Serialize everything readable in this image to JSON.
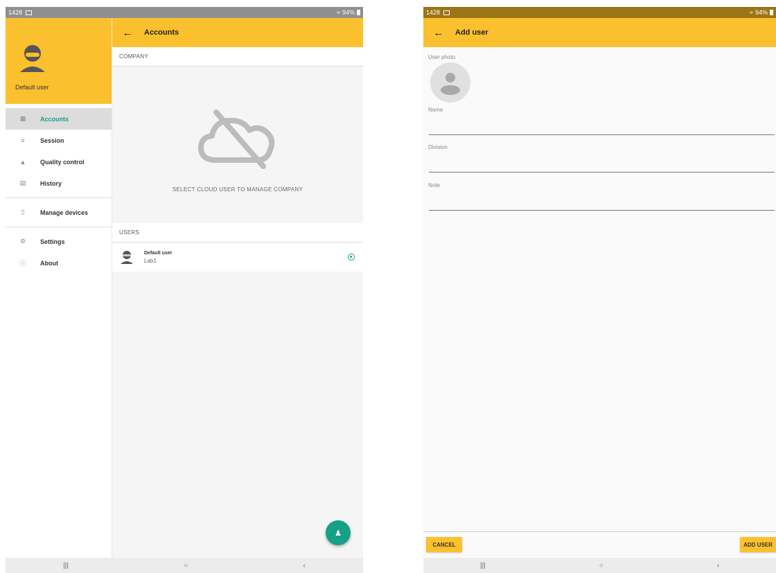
{
  "status_bar": {
    "time": "1428",
    "battery": "94%"
  },
  "left_screen": {
    "drawer": {
      "user_name": "Default user",
      "items": [
        {
          "label": "Accounts",
          "icon": "accounts-icon",
          "active": true
        },
        {
          "label": "Session",
          "icon": "session-icon"
        },
        {
          "label": "Quality control",
          "icon": "quality-control-icon"
        },
        {
          "label": "History",
          "icon": "history-icon"
        },
        {
          "label": "Manage devices",
          "icon": "device-icon"
        },
        {
          "label": "Settings",
          "icon": "gear-icon"
        },
        {
          "label": "About",
          "icon": "info-icon"
        }
      ]
    },
    "appbar": {
      "title": "Accounts"
    },
    "company_header": "COMPANY",
    "company_message": "SELECT CLOUD USER TO MANAGE COMPANY",
    "users_header": "USERS",
    "users": [
      {
        "name": "Default user",
        "sub": "Lab1",
        "selected": true
      }
    ],
    "fab_icon": "add-user-icon"
  },
  "right_screen": {
    "appbar": {
      "title": "Add user"
    },
    "fields": {
      "photo_label": "User photo",
      "name_label": "Name",
      "division_label": "Division",
      "note_label": "Note"
    },
    "buttons": {
      "cancel": "CANCEL",
      "add": "ADD USER"
    }
  },
  "colors": {
    "accent": "#fbc02d",
    "teal": "#16a085",
    "status_left": "#8f8f8f",
    "status_right": "#9c7418"
  }
}
